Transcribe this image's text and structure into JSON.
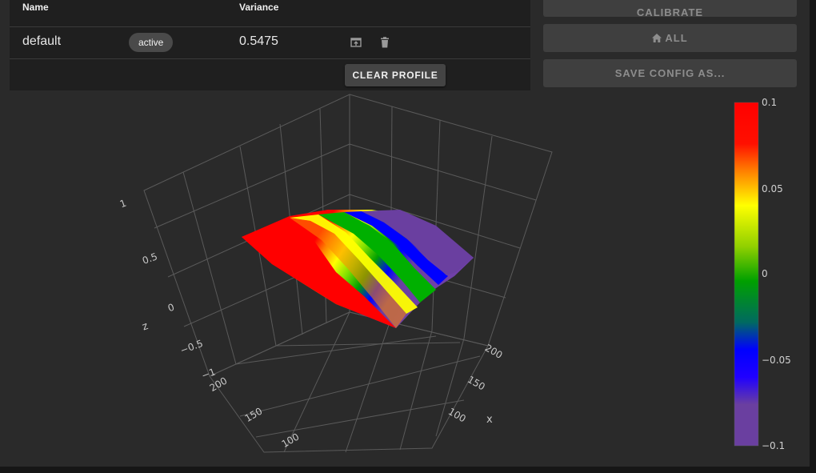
{
  "table": {
    "headers": {
      "name": "Name",
      "variance": "Variance"
    },
    "rows": [
      {
        "name": "default",
        "status": "active",
        "variance": "0.5475"
      }
    ],
    "clear_label": "CLEAR PROFILE"
  },
  "sidebar": {
    "calibrate_label": "CALIBRATE",
    "home_label": "ALL",
    "save_label": "SAVE CONFIG AS..."
  },
  "icons": {
    "load": "load-profile-icon",
    "delete": "delete-icon",
    "home": "home-icon"
  },
  "plot": {
    "z_axis_title": "z",
    "x_axis_title": "x",
    "z_ticks": [
      "1",
      "0.5",
      "0",
      "−0.5",
      "−1"
    ],
    "x_ticks": [
      "200",
      "150",
      "100"
    ],
    "y_ticks": [
      "200",
      "150",
      "100"
    ],
    "colorbar_ticks": [
      "0.1",
      "0.05",
      "0",
      "−0.05",
      "−0.1"
    ],
    "colorscale": [
      "#ff0000",
      "#ff4000",
      "#ffff00",
      "#00a000",
      "#00ff00",
      "#0000ff",
      "#6a3fa0"
    ]
  }
}
